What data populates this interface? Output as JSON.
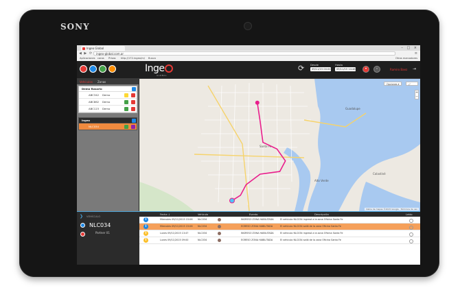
{
  "device": {
    "brand": "SONY"
  },
  "browser": {
    "tab_title": "Ingeo Global",
    "url": "ingeo-global.com.ar",
    "window_controls": "– □ ×",
    "nav_buttons": "◀ ▶ ⟳",
    "menu_icon": "≡",
    "bookmarks": [
      "Aplicaciones",
      "caros",
      "Prisas",
      "http://172.ingeo/m/",
      "Busca",
      "Otros marcadores"
    ]
  },
  "app": {
    "logo": "Inge",
    "logo_sub": "GLOBAL",
    "header_circles": [
      "#e53935",
      "#1e88e5",
      "#43a047",
      "#fb8c00"
    ],
    "refresh_icon": "⟳",
    "desde_label": "Desde",
    "desde_value": "09/11/15 00:00",
    "hasta_label": "Hasta",
    "hasta_value": "09/11/15 14:48",
    "username": "Ramiro Baez",
    "logout_icon": "⇥"
  },
  "sidebar": {
    "tabs": [
      "Vehículos",
      "Zonas"
    ],
    "group1": {
      "title": "Demo Rosario",
      "items": [
        {
          "id": "ABC342",
          "name": "Demo",
          "color": "#fdd835"
        },
        {
          "id": "ABC862",
          "name": "Demo",
          "color": "#43a047"
        },
        {
          "id": "ABC123",
          "name": "Demo",
          "color": "#43a047"
        }
      ]
    },
    "group2": {
      "title": "Ingeo",
      "items": [
        {
          "id": "NLC034",
          "name": "",
          "color": "#43a047"
        }
      ]
    }
  },
  "map": {
    "type_control": "Opciones ▾",
    "zoom_in": "+",
    "zoom_out": "−",
    "attribution": "Datos de mapas ©2015 Google · Términos de uso",
    "route_color": "#e91e8c",
    "route_points": [
      [
        0.42,
        0.18
      ],
      [
        0.43,
        0.32
      ],
      [
        0.44,
        0.48
      ],
      [
        0.49,
        0.53
      ],
      [
        0.52,
        0.62
      ],
      [
        0.5,
        0.7
      ],
      [
        0.43,
        0.72
      ],
      [
        0.38,
        0.8
      ],
      [
        0.36,
        0.88
      ],
      [
        0.33,
        0.92
      ]
    ],
    "labels": [
      "Santa Fe",
      "Guadalupe",
      "Alto Verde",
      "Colastiné"
    ]
  },
  "vehicle_panel": {
    "header": "VEHÍCULO",
    "name": "NLC034",
    "subtitle": "Partner 01"
  },
  "events": {
    "columns": [
      "Fecha ↓",
      "Vehículo",
      "Evento",
      "Descripción",
      "Leído"
    ],
    "rows": [
      {
        "icon": "#1e88e5",
        "fecha": "Miercoles 09/11/2015 15:06",
        "vehiculo": "NLC034",
        "evento": "INGRESO ZONA HABILITADA",
        "descripcion": "El vehículo NLC034 ingresó a la zona Oficina Santa Fe",
        "hl": false
      },
      {
        "icon": "#1e88e5",
        "fecha": "Miercoles 09/11/2015 15:06",
        "vehiculo": "NLC034",
        "evento": "EGRESO ZONA HABILITADA",
        "descripcion": "El vehículo NLC034 salió de la zona Oficina Santa Fe",
        "hl": true
      },
      {
        "icon": "#fbc02d",
        "fecha": "Lunes 09/11/2015 13:47",
        "vehiculo": "NLC034",
        "evento": "INGRESO ZONA HABILITADA",
        "descripcion": "El vehículo NLC034 ingresó a la zona Oficina Santa Fe",
        "hl": false
      },
      {
        "icon": "#fbc02d",
        "fecha": "Lunes 09/11/2015 09:00",
        "vehiculo": "NLC034",
        "evento": "EGRESO ZONA HABILITADA",
        "descripcion": "El vehículo NLC034 salió de la zona Oficina Santa Fe",
        "hl": false
      }
    ]
  }
}
